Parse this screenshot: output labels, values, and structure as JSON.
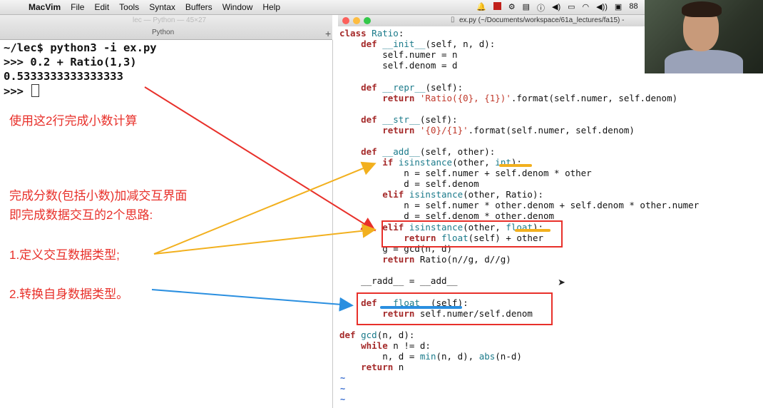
{
  "menubar": {
    "app": "MacVim",
    "menus": [
      "File",
      "Edit",
      "Tools",
      "Syntax",
      "Buffers",
      "Window",
      "Help"
    ],
    "status_partial": "88"
  },
  "terminal": {
    "title": "lec — Python — 45×27",
    "tab": "Python",
    "lines": [
      "~/lec$ python3 -i ex.py",
      ">>> 0.2 + Ratio(1,3)",
      "0.5333333333333333",
      ">>> "
    ]
  },
  "vim": {
    "title": "ex.py (~/Documents/workspace/61a_lectures/fa15) -"
  },
  "code": {
    "l01": "class Ratio:",
    "l02": "    def __init__(self, n, d):",
    "l03": "        self.numer = n",
    "l04": "        self.denom = d",
    "l05": "    def __repr__(self):",
    "l06": "        return 'Ratio({0}, {1})'.format(self.numer, self.denom)",
    "l07": "    def __str__(self):",
    "l08": "        return '{0}/{1}'.format(self.numer, self.denom)",
    "l09": "    def __add__(self, other):",
    "l10": "        if isinstance(other, int):",
    "l11": "            n = self.numer + self.denom * other",
    "l12": "            d = self.denom",
    "l13": "        elif isinstance(other, Ratio):",
    "l14": "            n = self.numer * other.denom + self.denom * other.numer",
    "l15": "            d = self.denom * other.denom",
    "l16": "        elif isinstance(other, float):",
    "l17": "            return float(self) + other",
    "l18": "        g = gcd(n, d)",
    "l19": "        return Ratio(n//g, d//g)",
    "l20": "    __radd__ = __add__",
    "l21": "    def __float__(self):",
    "l22": "        return self.numer/self.denom",
    "l23": "def gcd(n, d):",
    "l24": "    while n != d:",
    "l25": "        n, d = min(n, d), abs(n-d)",
    "l26": "    return n"
  },
  "annotations": {
    "a1": "使用这2行完成小数计算",
    "a2": "完成分数(包括小数)加减交互界面",
    "a3": "即完成数据交互的2个思路:",
    "a4": "1.定义交互数据类型;",
    "a5": "2.转换自身数据类型。"
  },
  "colors": {
    "red": "#e8302a",
    "yellow": "#f2b01e",
    "blue": "#2a8fe0"
  }
}
